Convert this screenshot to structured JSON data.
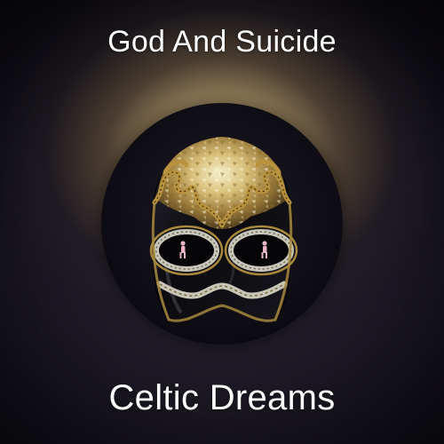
{
  "cover": {
    "song_title": "God And Suicide",
    "artist_name": "Celtic Dreams",
    "artwork": "venetian-mask",
    "colors": {
      "text": "#ffffff",
      "mask_black": "#0b0a0e",
      "mask_gold": "#c9a54a",
      "mask_silver": "#c8c6b8",
      "glow": "#f0dcaa",
      "background": "#0c0a12"
    }
  }
}
